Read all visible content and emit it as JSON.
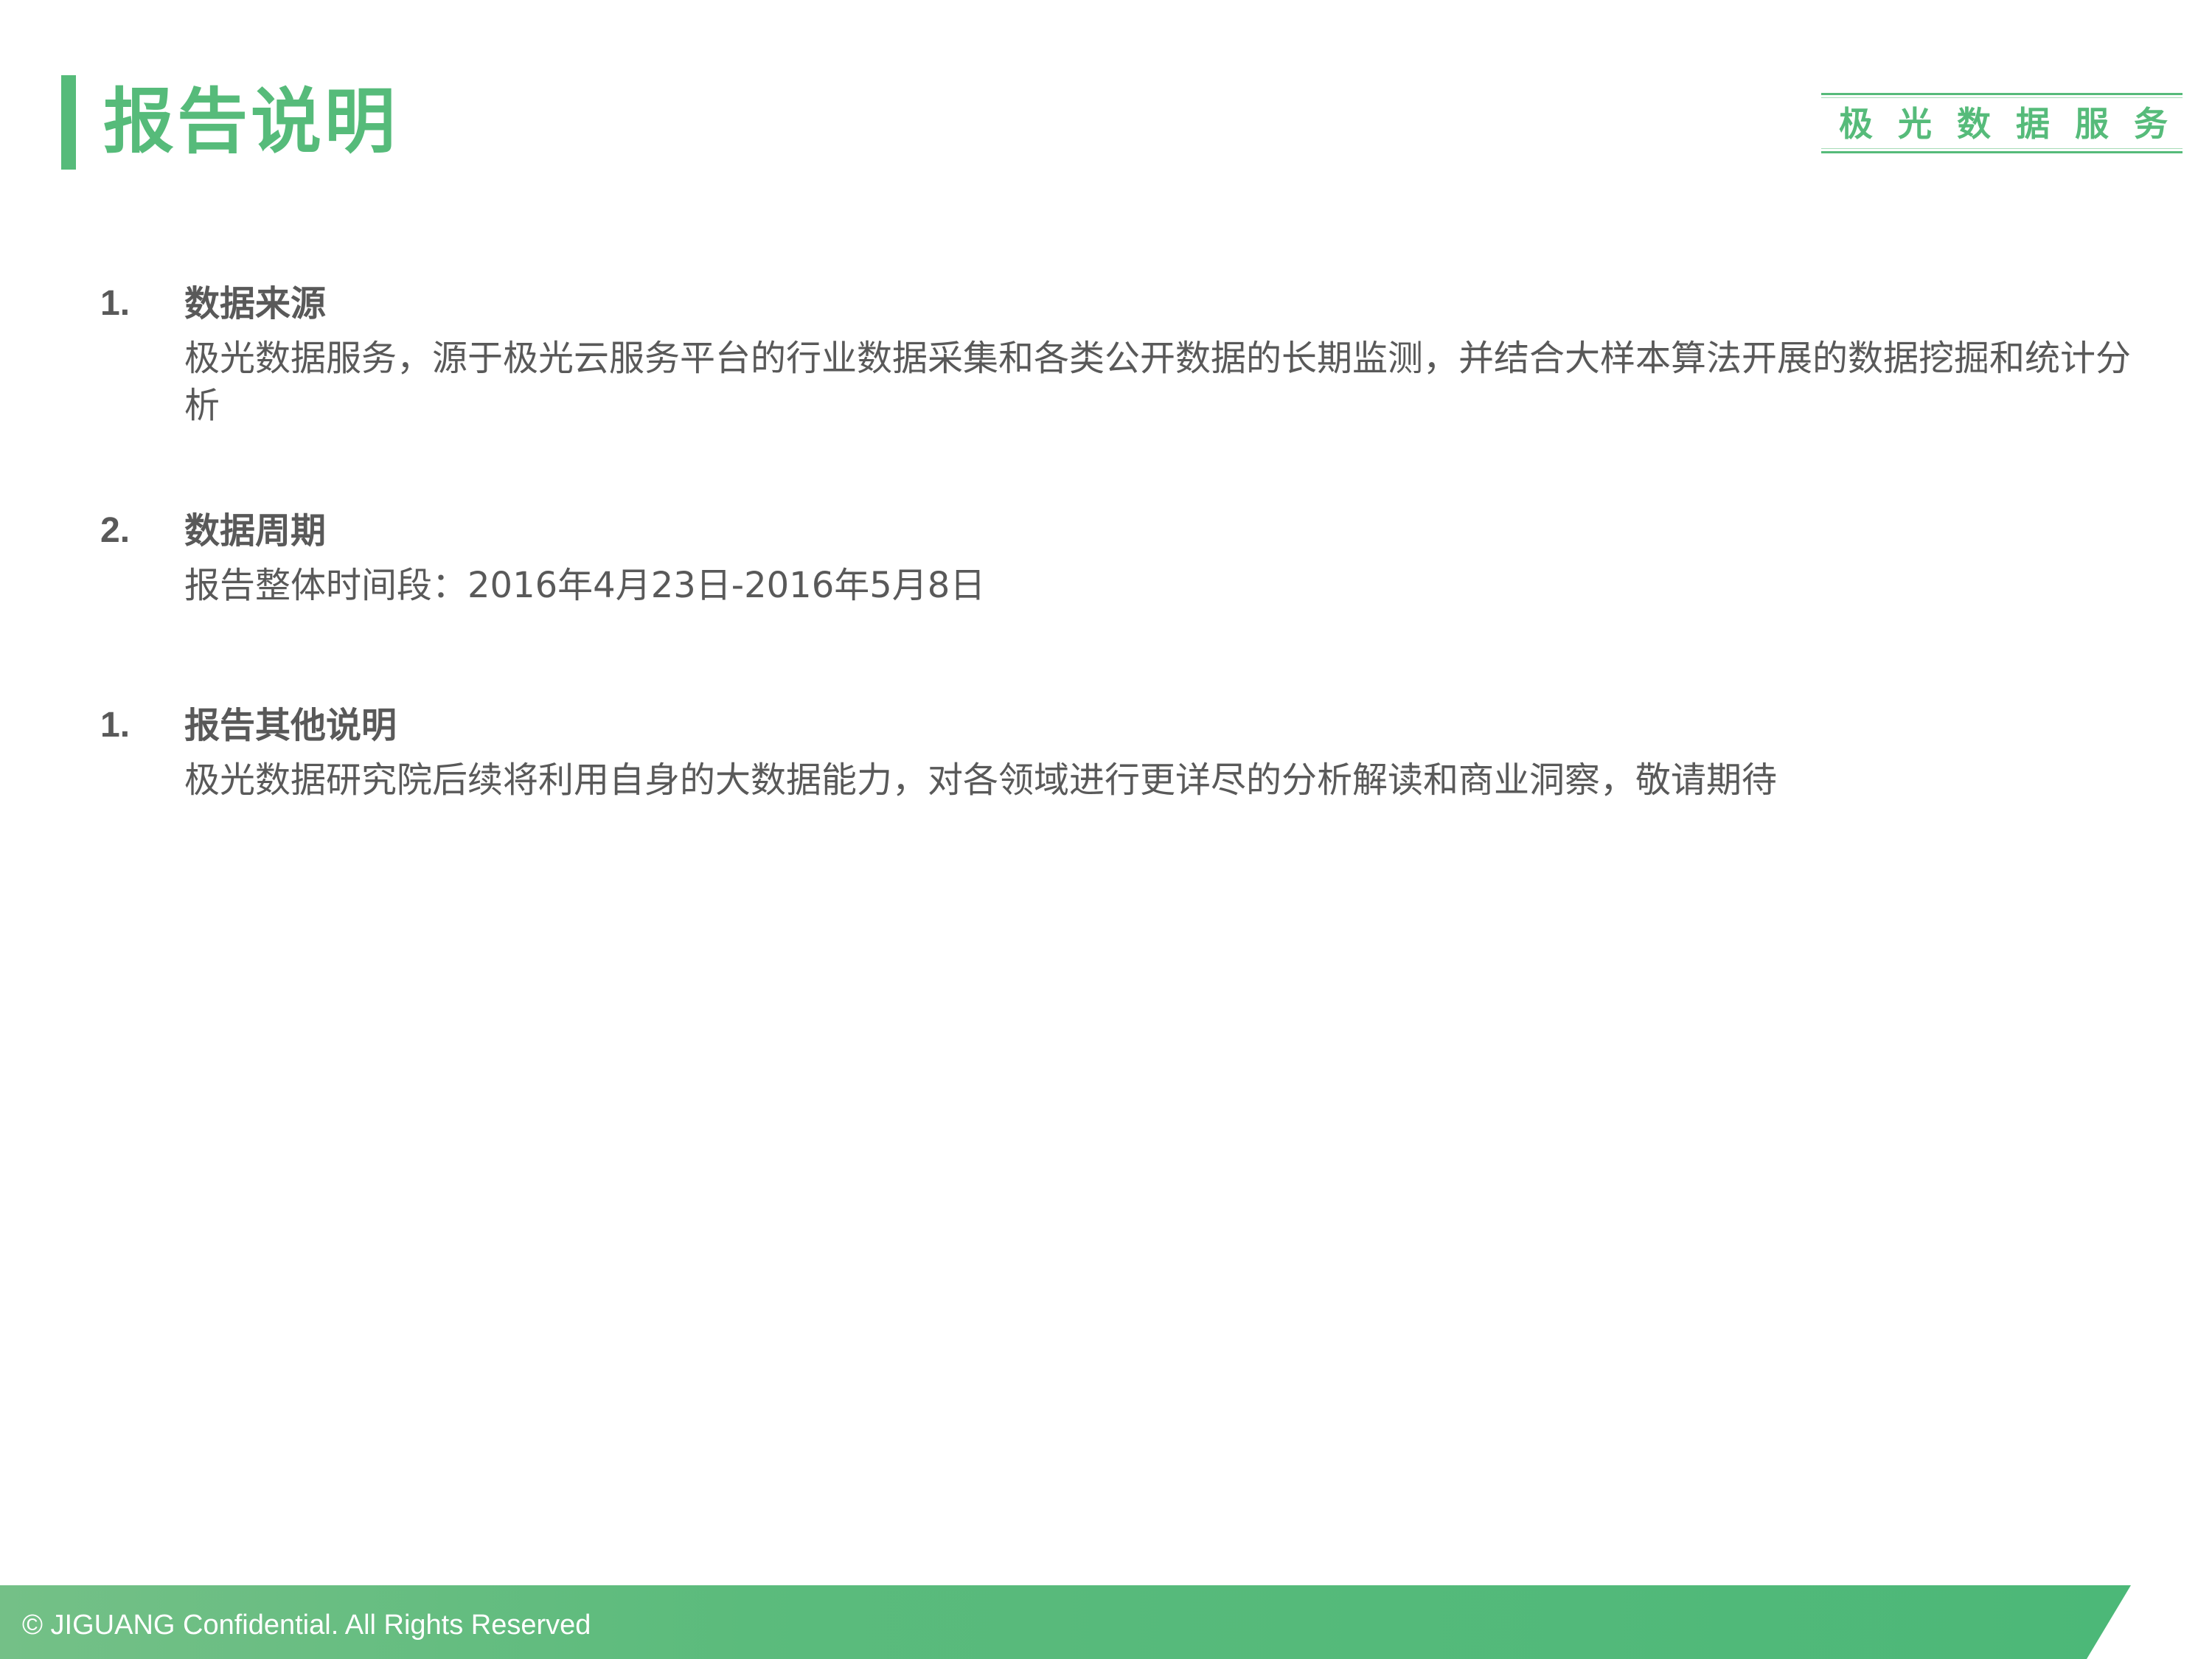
{
  "header": {
    "title": "报告说明",
    "brand": "极光数据服务"
  },
  "sections": [
    {
      "number": "1.",
      "heading": "数据来源",
      "body": "极光数据服务，源于极光云服务平台的行业数据采集和各类公开数据的长期监测，并结合大样本算法开展的数据挖掘和统计分析"
    },
    {
      "number": "2.",
      "heading": "数据周期",
      "body": "报告整体时间段：2016年4月23日-2016年5月8日"
    },
    {
      "number": "1.",
      "heading": "报告其他说明",
      "body": "极光数据研究院后续将利用自身的大数据能力，对各领域进行更详尽的分析解读和商业洞察，敬请期待"
    }
  ],
  "footer": {
    "text": "© JIGUANG Confidential. All Rights Reserved"
  },
  "colors": {
    "accent": "#56bb7a",
    "body_text": "#595959"
  }
}
